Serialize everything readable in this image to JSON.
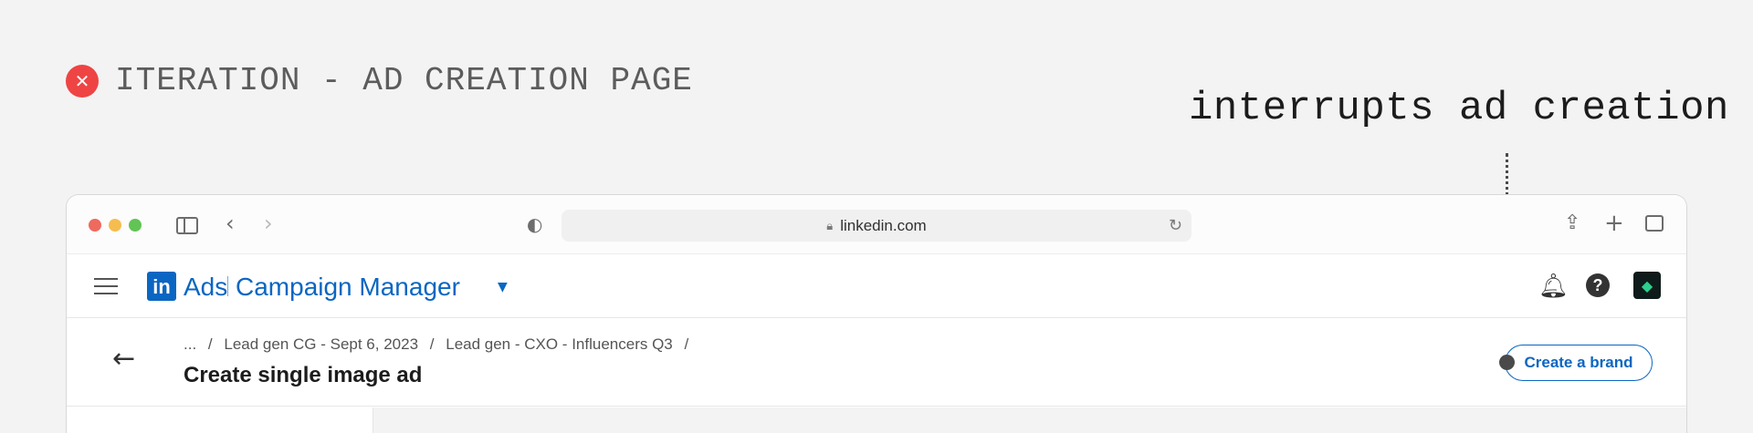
{
  "heading": {
    "icon": "close-icon",
    "text": "ITERATION - AD CREATION PAGE"
  },
  "annotation": {
    "text": "interrupts ad creation"
  },
  "browser": {
    "url": "linkedin.com",
    "icons": [
      "sidebar-icon",
      "back-icon",
      "forward-icon",
      "shield-icon",
      "lock-icon",
      "reload-icon",
      "share-icon",
      "new-tab-icon",
      "tabs-icon"
    ]
  },
  "appbar": {
    "logo_text": "in",
    "ads": "Ads",
    "product": "Campaign Manager",
    "help_glyph": "?"
  },
  "page": {
    "breadcrumb": [
      "...",
      "/",
      "Lead gen CG - Sept 6, 2023",
      "/",
      "Lead gen - CXO - Influencers Q3",
      "/"
    ],
    "title": "Create single image ad",
    "create_brand_label": "Create a brand"
  },
  "colors": {
    "accent": "#0a66c2",
    "error": "#ef4444",
    "background": "#f3f3f3"
  }
}
